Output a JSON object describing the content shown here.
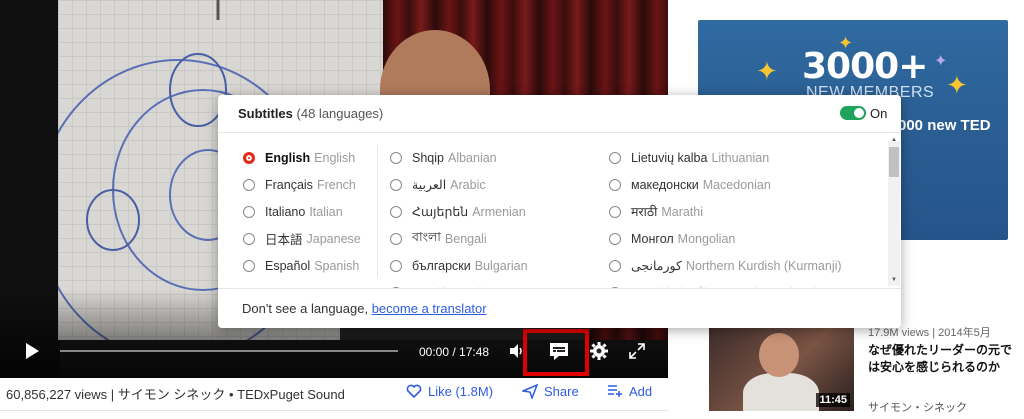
{
  "video": {
    "time_display": "00:00 / 17:48",
    "progress": 0.0
  },
  "meta": {
    "views_line": "60,856,227 views | サイモン シネック • TEDxPuget Sound",
    "like_label": "Like (1.8M)",
    "share_label": "Share",
    "add_label": "Add"
  },
  "banner": {
    "headline": "3000+",
    "subhead": "NEW MEMBERS",
    "partial_text": "000 new TED"
  },
  "related": {
    "views": "17.9M views | 2014年5月",
    "title": "なぜ優れたリーダーの元では安心を感じられるのか",
    "speaker": "サイモン・シネック",
    "duration": "11:45"
  },
  "subtitles_popup": {
    "title": "Subtitles",
    "count": "(48 languages)",
    "toggle_label": "On",
    "toggle_on": true,
    "columns": [
      [
        {
          "native": "English",
          "english": "English",
          "selected": true
        },
        {
          "native": "Français",
          "english": "French",
          "selected": false
        },
        {
          "native": "Italiano",
          "english": "Italian",
          "selected": false
        },
        {
          "native": "日本語",
          "english": "Japanese",
          "selected": false
        },
        {
          "native": "Español",
          "english": "Spanish",
          "selected": false
        }
      ],
      [
        {
          "native": "Shqip",
          "english": "Albanian",
          "selected": false
        },
        {
          "native": "العربية",
          "english": "Arabic",
          "selected": false
        },
        {
          "native": "Հայերեն",
          "english": "Armenian",
          "selected": false
        },
        {
          "native": "বাংলা",
          "english": "Bengali",
          "selected": false
        },
        {
          "native": "български",
          "english": "Bulgarian",
          "selected": false
        },
        {
          "native": "Català",
          "english": "Catalan",
          "selected": false,
          "partial": true
        }
      ],
      [
        {
          "native": "Lietuvių kalba",
          "english": "Lithuanian",
          "selected": false
        },
        {
          "native": "македонски",
          "english": "Macedonian",
          "selected": false
        },
        {
          "native": "मराठी",
          "english": "Marathi",
          "selected": false
        },
        {
          "native": "Монгол",
          "english": "Mongolian",
          "selected": false
        },
        {
          "native": "کورمانجی",
          "english": "Northern Kurdish (Kurmanji)",
          "selected": false
        },
        {
          "native": "Norsk bokmål",
          "english": "Norwegian Bokmal",
          "selected": false,
          "partial": true
        }
      ]
    ],
    "footer_text": "Don't see a language,",
    "footer_link": "become a translator"
  },
  "colors": {
    "accent_link": "#2f5ce0",
    "selected_radio": "#e4291b",
    "toggle_on": "#20a35a",
    "highlight_box": "#e00000"
  }
}
